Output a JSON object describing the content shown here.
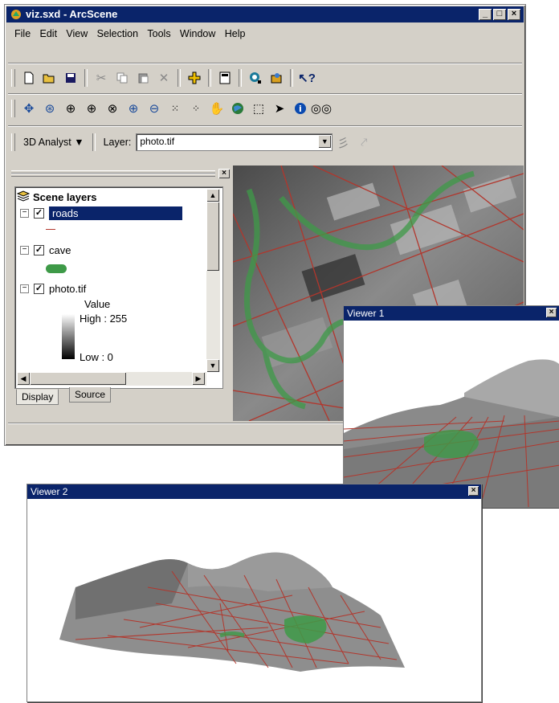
{
  "main_window": {
    "title": "viz.sxd - ArcScene",
    "controls": [
      "_",
      "□",
      "×"
    ]
  },
  "menu": [
    "File",
    "Edit",
    "View",
    "Selection",
    "Tools",
    "Window",
    "Help"
  ],
  "toolbar_3d": {
    "analyst_label": "3D Analyst ▼",
    "layer_label": "Layer:",
    "layer_value": "photo.tif"
  },
  "toc": {
    "root_label": "Scene layers",
    "layers": [
      {
        "name": "roads",
        "checked": "✓",
        "selected": true
      },
      {
        "name": "cave",
        "checked": "✓",
        "selected": false
      },
      {
        "name": "photo.tif",
        "checked": "✓",
        "selected": false
      }
    ],
    "legend_value": "Value",
    "legend_high": "High : 255",
    "legend_low": "Low : 0",
    "tabs": [
      "Display",
      "Source"
    ]
  },
  "viewer1": {
    "title": "Viewer 1"
  },
  "viewer2": {
    "title": "Viewer 2"
  },
  "colors": {
    "titlebar": "#0a246a",
    "road": "#b2362c",
    "cave": "#3e9a48",
    "chrome": "#d4d0c8"
  }
}
